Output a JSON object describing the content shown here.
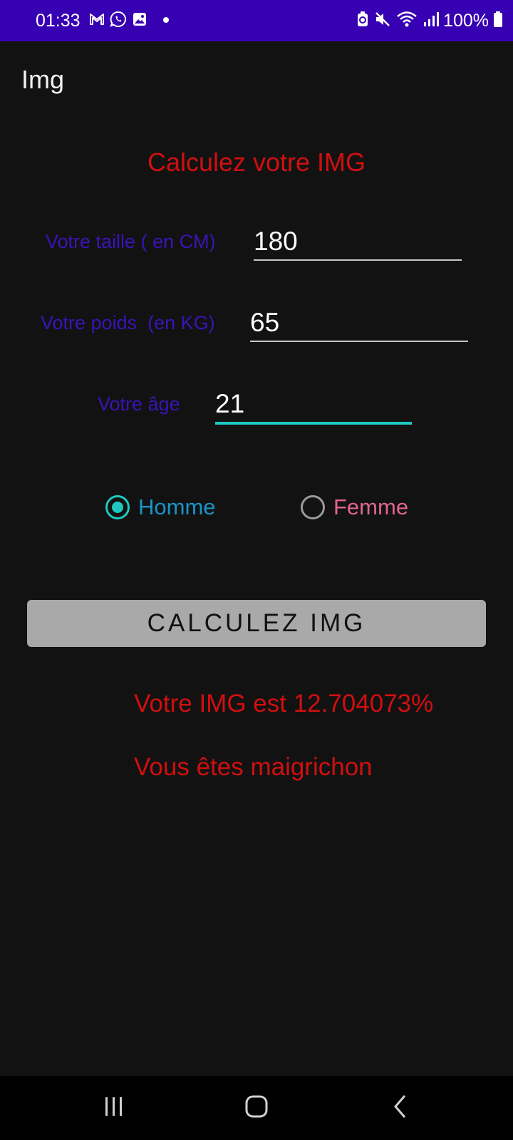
{
  "status_bar": {
    "time": "01:33",
    "left_icons": [
      "gmail-icon",
      "whatsapp-icon",
      "gallery-icon",
      "dot-icon"
    ],
    "right_icons": [
      "battery-saver-icon",
      "mute-icon",
      "wifi-icon",
      "signal-icon"
    ],
    "battery": "100%"
  },
  "app_bar": {
    "title": "Img"
  },
  "form": {
    "heading": "Calculez votre IMG",
    "height_label": "Votre taille ( en CM)",
    "height_value": "180",
    "weight_label": "Votre poids  (en KG)",
    "weight_value": "65",
    "age_label": "Votre âge",
    "age_value": "21"
  },
  "gender": {
    "male_label": "Homme",
    "female_label": "Femme",
    "selected": "Homme"
  },
  "button": {
    "label": "CALCULEZ IMG"
  },
  "result": {
    "value_text": "Votre IMG est 12.704073%",
    "comment": "Vous êtes maigrichon"
  },
  "nav_bar": {
    "buttons": [
      "recent-apps-icon",
      "home-icon",
      "back-icon"
    ]
  },
  "colors": {
    "status_bar": "#3700b3",
    "background": "#121212",
    "accent": "#1ec8c0",
    "label": "#3a14b8",
    "heading_red": "#d10f0f",
    "male_blue": "#1a94c8",
    "female_pink": "#e0658f",
    "button_gray": "#a9a9a9"
  }
}
